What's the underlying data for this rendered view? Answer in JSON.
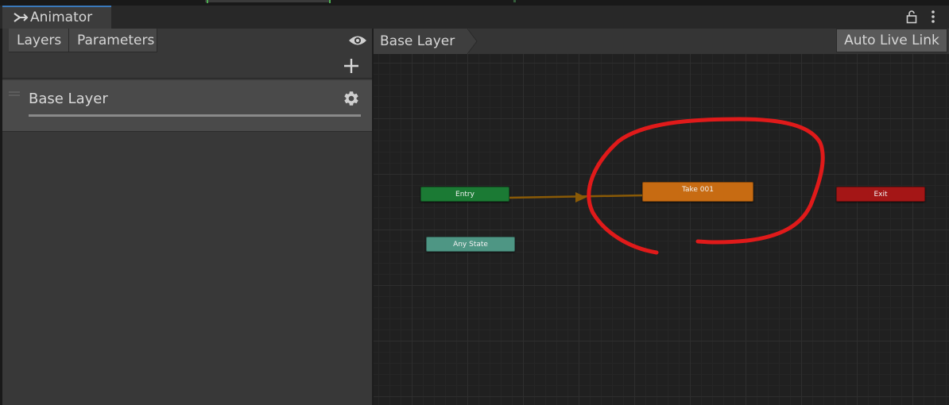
{
  "window": {
    "tab_title": "Animator",
    "tab_icon": "animator-icon"
  },
  "left_panel": {
    "tabs": [
      "Layers",
      "Parameters"
    ],
    "layers": [
      {
        "label": "Base Layer"
      }
    ]
  },
  "graph": {
    "breadcrumb": "Base Layer",
    "auto_live_link_label": "Auto Live Link",
    "nodes": {
      "entry": {
        "label": "Entry",
        "color": "#1b7a34"
      },
      "any_state": {
        "label": "Any State",
        "color": "#4e9684"
      },
      "take": {
        "label": "Take 001",
        "color": "#c76b12"
      },
      "exit": {
        "label": "Exit",
        "color": "#a41616"
      }
    },
    "annotation_color": "#e01a1a",
    "transition_color": "#8a5a06"
  }
}
